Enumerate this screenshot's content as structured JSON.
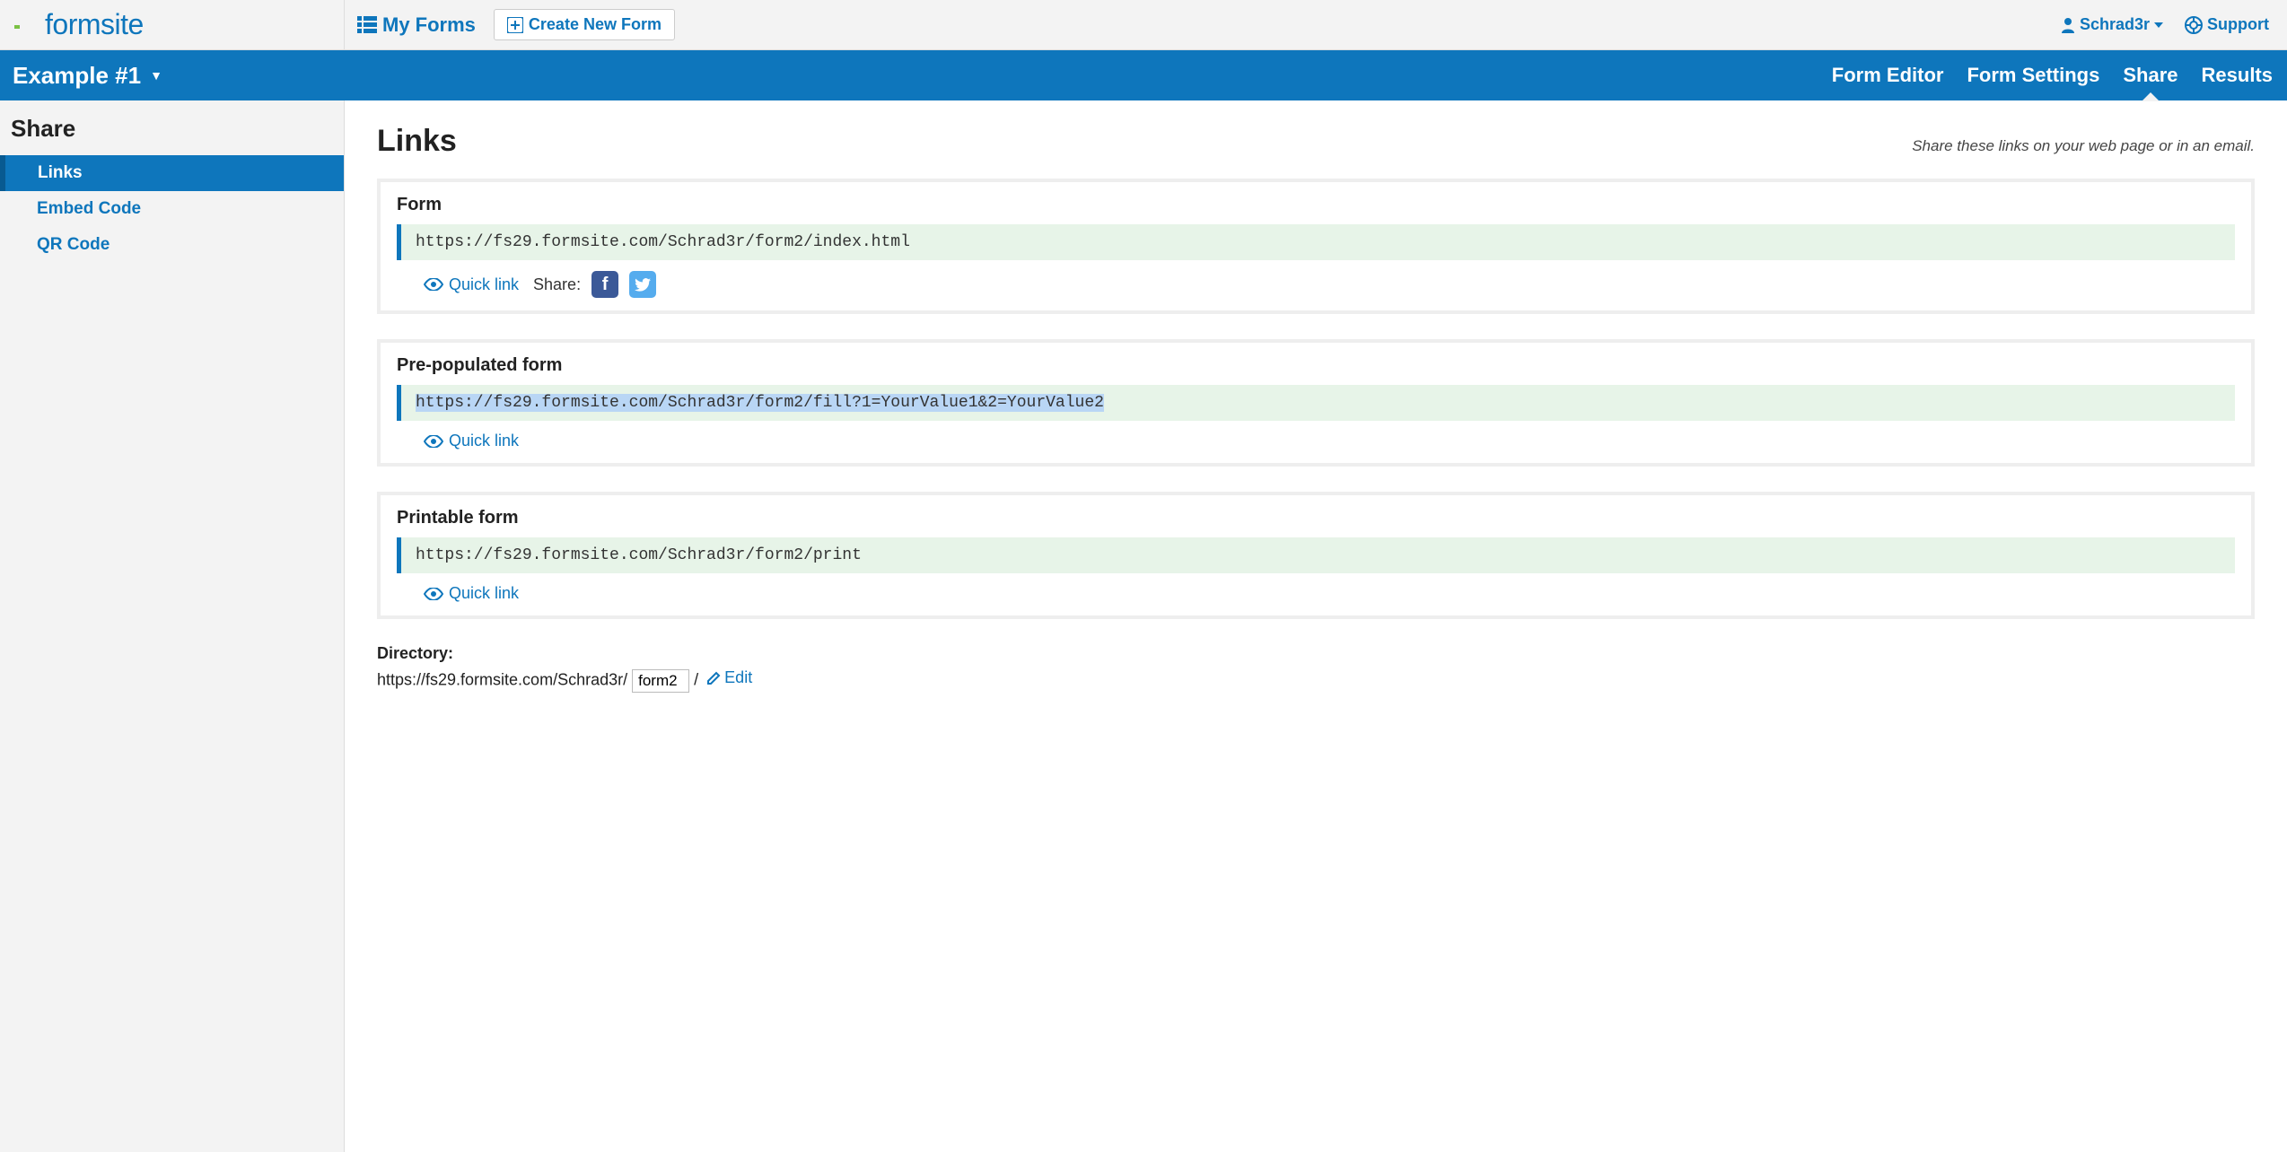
{
  "brand": "formsite",
  "topnav": {
    "my_forms": "My Forms",
    "create_new": "Create New Form"
  },
  "user": {
    "name": "Schrad3r",
    "support": "Support"
  },
  "bluebar": {
    "form_name": "Example #1",
    "tabs": {
      "editor": "Form Editor",
      "settings": "Form Settings",
      "share": "Share",
      "results": "Results"
    }
  },
  "sidebar": {
    "title": "Share",
    "items": {
      "links": "Links",
      "embed": "Embed Code",
      "qr": "QR Code"
    }
  },
  "main": {
    "title": "Links",
    "subtitle": "Share these links on your web page or in an email.",
    "panels": {
      "form": {
        "title": "Form",
        "url": "https://fs29.formsite.com/Schrad3r/form2/index.html",
        "quick_link": "Quick link",
        "share_label": "Share:"
      },
      "prepop": {
        "title": "Pre-populated form",
        "url": "https://fs29.formsite.com/Schrad3r/form2/fill?1=YourValue1&2=YourValue2",
        "quick_link": "Quick link"
      },
      "printable": {
        "title": "Printable form",
        "url": "https://fs29.formsite.com/Schrad3r/form2/print",
        "quick_link": "Quick link"
      }
    },
    "directory": {
      "label": "Directory:",
      "prefix": "https://fs29.formsite.com/Schrad3r/",
      "value": "form2",
      "suffix": "/",
      "edit": "Edit"
    }
  }
}
